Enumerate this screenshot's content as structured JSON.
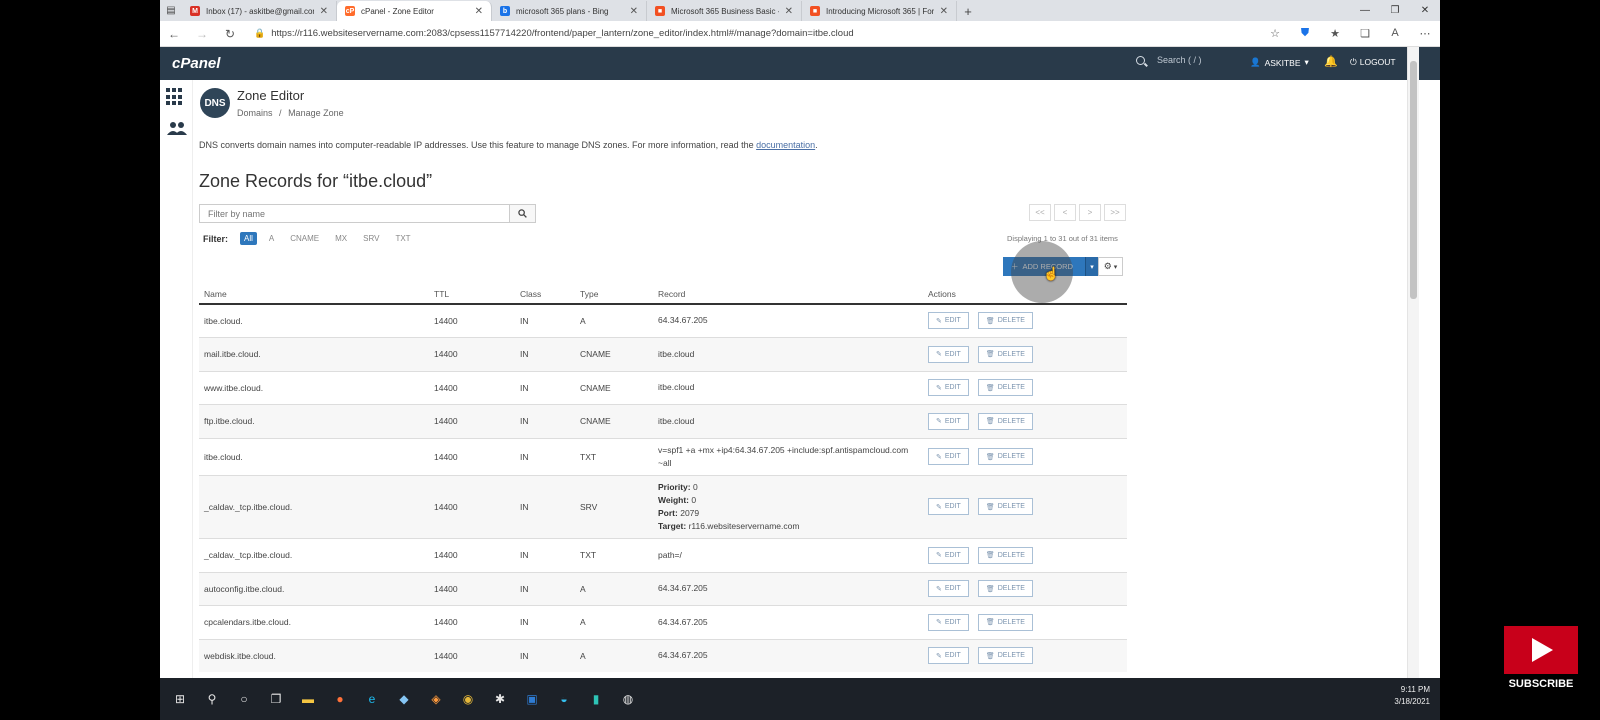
{
  "browser": {
    "tabs": [
      {
        "title": "Inbox (17) - askitbe@gmail.com",
        "favicon": "gmail-icon",
        "color": "#d93025",
        "letter": "M"
      },
      {
        "title": "cPanel - Zone Editor",
        "favicon": "cpanel-icon",
        "color": "#ff6c2c",
        "letter": "cP",
        "active": true
      },
      {
        "title": "microsoft 365 plans - Bing",
        "favicon": "bing-icon",
        "color": "#1a73e8",
        "letter": "b"
      },
      {
        "title": "Microsoft 365 Business Basic - ...",
        "favicon": "microsoft-icon",
        "color": "#f25022",
        "letter": "■"
      },
      {
        "title": "Introducing Microsoft 365 | For...",
        "favicon": "microsoft-icon",
        "color": "#f25022",
        "letter": "■"
      }
    ],
    "url": "https://r116.websiteservername.com:2083/cpsess1157714220/frontend/paper_lantern/zone_editor/index.html#/manage?domain=itbe.cloud"
  },
  "cpanel": {
    "logo": "cPanel",
    "search_placeholder": "Search ( / )",
    "user": "ASKITBE",
    "logout": "LOGOUT"
  },
  "page": {
    "app_title": "Zone Editor",
    "dns_badge": "DNS",
    "breadcrumb_root": "Domains",
    "breadcrumb_sep": "/",
    "breadcrumb_current": "Manage Zone",
    "intro_text": "DNS converts domain names into computer-readable IP addresses. Use this feature to manage DNS zones. For more information, read the ",
    "intro_link": "documentation",
    "intro_end": ".",
    "zone_title": "Zone Records for “itbe.cloud”",
    "filter_placeholder": "Filter by name",
    "filter_label": "Filter:",
    "filter_chips": [
      "All",
      "A",
      "CNAME",
      "MX",
      "SRV",
      "TXT"
    ],
    "pager": [
      "<<",
      "<",
      ">",
      ">>"
    ],
    "displaying": "Displaying 1 to 31 out of 31 items",
    "add_record": "ADD RECORD"
  },
  "table": {
    "columns": [
      "Name",
      "TTL",
      "Class",
      "Type",
      "Record",
      "Actions"
    ],
    "edit_label": "EDIT",
    "delete_label": "DELETE",
    "rows": [
      {
        "name": "itbe.cloud.",
        "ttl": "14400",
        "class": "IN",
        "type": "A",
        "record": "64.34.67.205"
      },
      {
        "name": "mail.itbe.cloud.",
        "ttl": "14400",
        "class": "IN",
        "type": "CNAME",
        "record": "itbe.cloud"
      },
      {
        "name": "www.itbe.cloud.",
        "ttl": "14400",
        "class": "IN",
        "type": "CNAME",
        "record": "itbe.cloud"
      },
      {
        "name": "ftp.itbe.cloud.",
        "ttl": "14400",
        "class": "IN",
        "type": "CNAME",
        "record": "itbe.cloud"
      },
      {
        "name": "itbe.cloud.",
        "ttl": "14400",
        "class": "IN",
        "type": "TXT",
        "record": "v=spf1 +a +mx +ip4:64.34.67.205 +include:spf.antispamcloud.com ~all"
      },
      {
        "name": "_caldav._tcp.itbe.cloud.",
        "ttl": "14400",
        "class": "IN",
        "type": "SRV",
        "srv": {
          "priority": "0",
          "weight": "0",
          "port": "2079",
          "target": "r116.websiteservername.com"
        }
      },
      {
        "name": "_caldav._tcp.itbe.cloud.",
        "ttl": "14400",
        "class": "IN",
        "type": "TXT",
        "record": "path=/"
      },
      {
        "name": "autoconfig.itbe.cloud.",
        "ttl": "14400",
        "class": "IN",
        "type": "A",
        "record": "64.34.67.205"
      },
      {
        "name": "cpcalendars.itbe.cloud.",
        "ttl": "14400",
        "class": "IN",
        "type": "A",
        "record": "64.34.67.205"
      },
      {
        "name": "webdisk.itbe.cloud.",
        "ttl": "14400",
        "class": "IN",
        "type": "A",
        "record": "64.34.67.205"
      }
    ]
  },
  "srv_labels": {
    "priority": "Priority:",
    "weight": "Weight:",
    "port": "Port:",
    "target": "Target:"
  },
  "taskbar": {
    "time": "9:11 PM",
    "date": "3/18/2021"
  },
  "subscribe": "SUBSCRIBE"
}
